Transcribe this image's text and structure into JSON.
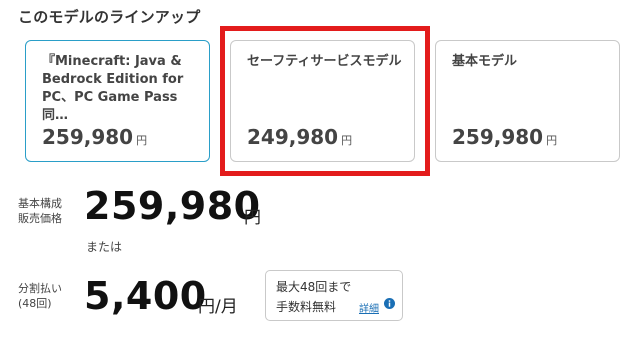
{
  "section": {
    "title": "このモデルのラインアップ"
  },
  "lineup": [
    {
      "name": "『Minecraft: Java & Bedrock Edition for PC、PC Game Pass同…",
      "price": "259,980",
      "currency": "円"
    },
    {
      "name": "セーフティサービスモデル",
      "price": "249,980",
      "currency": "円"
    },
    {
      "name": "基本モデル",
      "price": "259,980",
      "currency": "円"
    }
  ],
  "pricing": {
    "base_label_line1": "基本構成",
    "base_label_line2": "販売価格",
    "base_price": "259,980",
    "base_unit": "円",
    "or_text": "または",
    "installment_label_line1": "分割払い",
    "installment_label_line2": "(48回)",
    "installment_price": "5,400",
    "installment_unit": "円/月",
    "info_line1": "最大48回まで",
    "info_line2": "手数料無料",
    "detail_link": "詳細"
  },
  "colors": {
    "selected_border": "#2a9ec8",
    "highlight": "#e31c1c",
    "link": "#1a6fb5"
  }
}
